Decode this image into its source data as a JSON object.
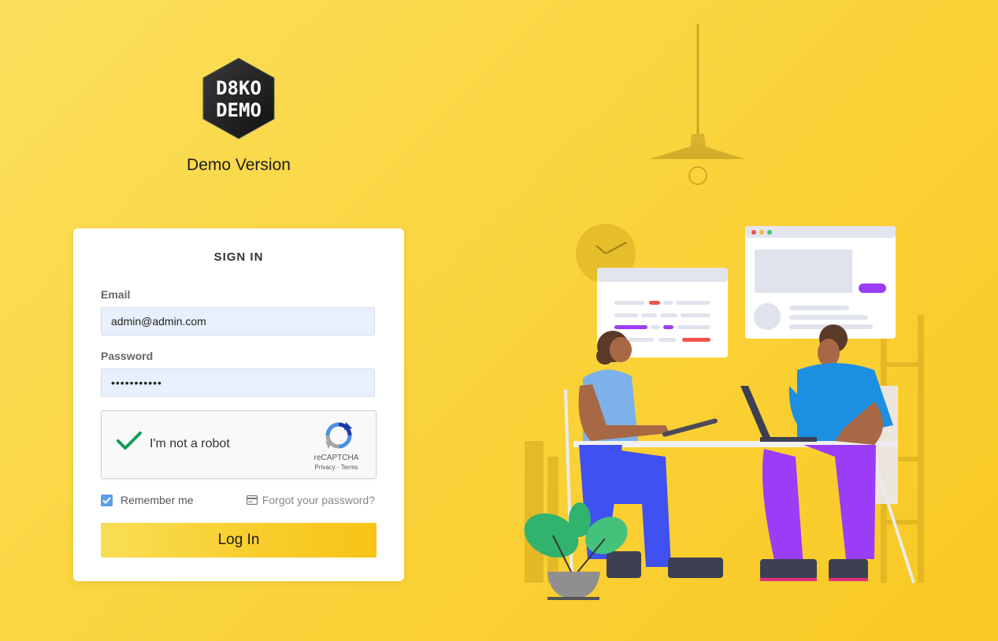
{
  "brand": {
    "logo_line1": "D8KO",
    "logo_line2": "DEMO",
    "version_label": "Demo Version"
  },
  "signin": {
    "title": "SIGN IN",
    "email_label": "Email",
    "email_value": "admin@admin.com",
    "password_label": "Password",
    "password_value": "•••••••••••",
    "captcha": {
      "label": "I'm not a robot",
      "brand": "reCAPTCHA",
      "links": "Privacy - Terms",
      "checked": true
    },
    "remember_label": "Remember me",
    "remember_checked": true,
    "forgot_label": "Forgot your password?",
    "login_button": "Log In"
  },
  "colors": {
    "background": "#fad53f",
    "accent": "#f9c823",
    "input_fill": "#e8f0fe",
    "check_green": "#0f9d58",
    "checkbox_blue": "#5b9ee6",
    "purple": "#9b3df6",
    "blue_pants": "#3f51f0"
  },
  "icons": {
    "captcha_check": "checkmark-icon",
    "captcha_logo": "recaptcha-icon",
    "remember": "checkbox-icon",
    "forgot": "credit-card-icon"
  }
}
